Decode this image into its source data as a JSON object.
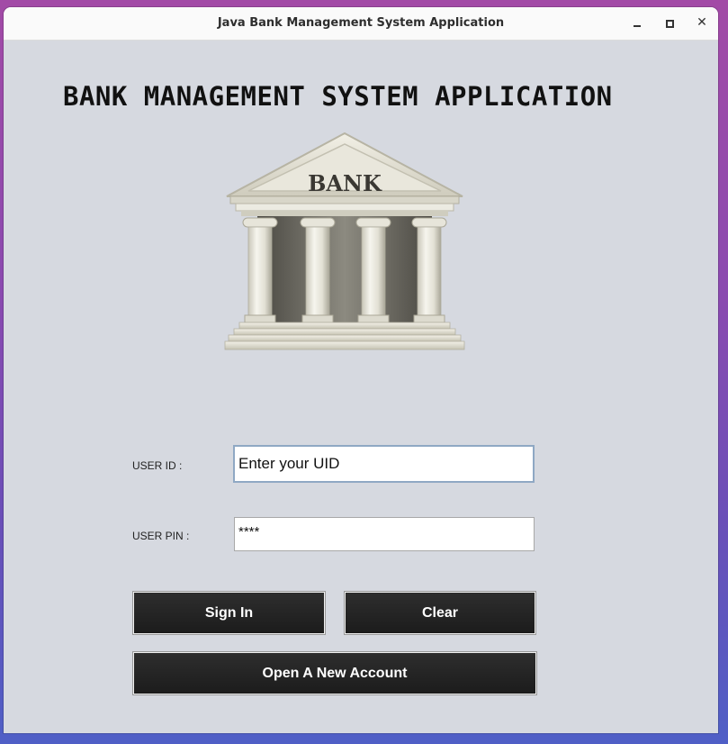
{
  "window": {
    "title": "Java Bank Management System Application",
    "close_glyph": "✕"
  },
  "main": {
    "heading": "BANK MANAGEMENT SYSTEM APPLICATION",
    "bank_sign_text": "BANK"
  },
  "form": {
    "user_id_label": "USER ID :",
    "user_id_value": "Enter your UID",
    "user_pin_label": "USER PIN :",
    "user_pin_value": "****"
  },
  "buttons": {
    "sign_in": "Sign In",
    "clear": "Clear",
    "open_account": "Open A New Account"
  },
  "icons": {
    "minimize": "minimize-icon",
    "maximize": "maximize-icon",
    "close": "close-icon",
    "bank": "bank-building-icon"
  },
  "colors": {
    "window_background": "#d6d9e0",
    "button_background": "#232323",
    "button_text": "#ffffff",
    "title_bar": "#fafafa"
  }
}
